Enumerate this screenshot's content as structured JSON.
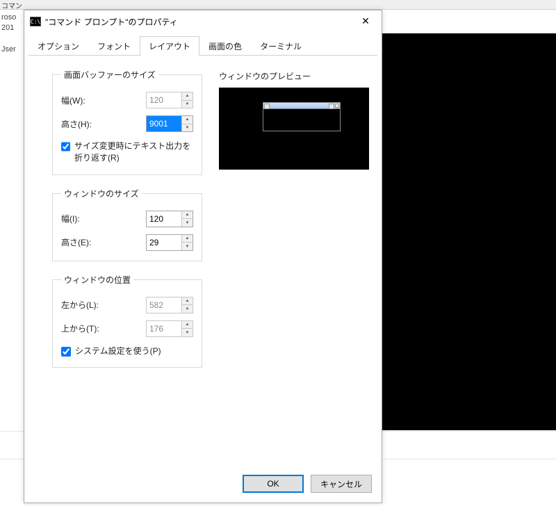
{
  "background": {
    "topbar_fragment": "コマン",
    "left_fragment_1": "roso",
    "left_fragment_2": "201",
    "left_fragment_3": "Jser"
  },
  "dialog": {
    "title": "\"コマンド プロンプト\"のプロパティ",
    "close_glyph": "✕"
  },
  "tabs": {
    "options": "オプション",
    "font": "フォント",
    "layout": "レイアウト",
    "colors": "画面の色",
    "terminal": "ターミナル"
  },
  "buffer": {
    "legend": "画面バッファーのサイズ",
    "width_label": "幅(W):",
    "width_value": "120",
    "height_label": "高さ(H):",
    "height_value": "9001",
    "wrap_label": "サイズ変更時にテキスト出力を折り返す(R)"
  },
  "window_size": {
    "legend": "ウィンドウのサイズ",
    "width_label": "幅(I):",
    "width_value": "120",
    "height_label": "高さ(E):",
    "height_value": "29"
  },
  "window_pos": {
    "legend": "ウィンドウの位置",
    "left_label": "左から(L):",
    "left_value": "582",
    "top_label": "上から(T):",
    "top_value": "176",
    "system_label": "システム設定を使う(P)"
  },
  "preview": {
    "title": "ウィンドウのプレビュー"
  },
  "buttons": {
    "ok": "OK",
    "cancel": "キャンセル"
  }
}
